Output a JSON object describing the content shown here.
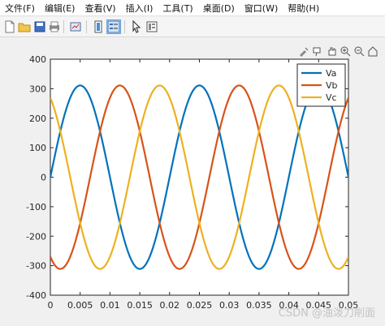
{
  "menu": [
    "文件(F)",
    "编辑(E)",
    "查看(V)",
    "插入(I)",
    "工具(T)",
    "桌面(D)",
    "窗口(W)",
    "帮助(H)"
  ],
  "toolbar_icons": [
    "new-file-icon",
    "open-folder-icon",
    "save-icon",
    "print-icon",
    "link-plot-icon",
    "insert-colorbar-icon",
    "insert-legend-icon",
    "edit-plot-arrow-icon",
    "property-inspector-icon"
  ],
  "axes_toolbar_icons": [
    "brush-icon",
    "data-tips-icon",
    "pan-icon",
    "zoom-in-icon",
    "zoom-out-icon",
    "home-icon"
  ],
  "watermark": "CSDN @油泼刀削面",
  "chart_data": {
    "type": "line",
    "title": "",
    "xlabel": "",
    "ylabel": "",
    "xlim": [
      0,
      0.05
    ],
    "ylim": [
      -400,
      400
    ],
    "xticks": [
      "0",
      "0.005",
      "0.01",
      "0.015",
      "0.02",
      "0.025",
      "0.03",
      "0.035",
      "0.04",
      "0.045",
      "0.05"
    ],
    "yticks": [
      "-400",
      "-300",
      "-200",
      "-100",
      "0",
      "100",
      "200",
      "300",
      "400"
    ],
    "grid": false,
    "legend_position": "top-right",
    "frequency_hz": 50,
    "amplitude": 311,
    "series": [
      {
        "name": "Va",
        "color": "#0072BD",
        "phase_deg": 0
      },
      {
        "name": "Vb",
        "color": "#D95319",
        "phase_deg": -120
      },
      {
        "name": "Vc",
        "color": "#EDB120",
        "phase_deg": 120
      }
    ]
  }
}
